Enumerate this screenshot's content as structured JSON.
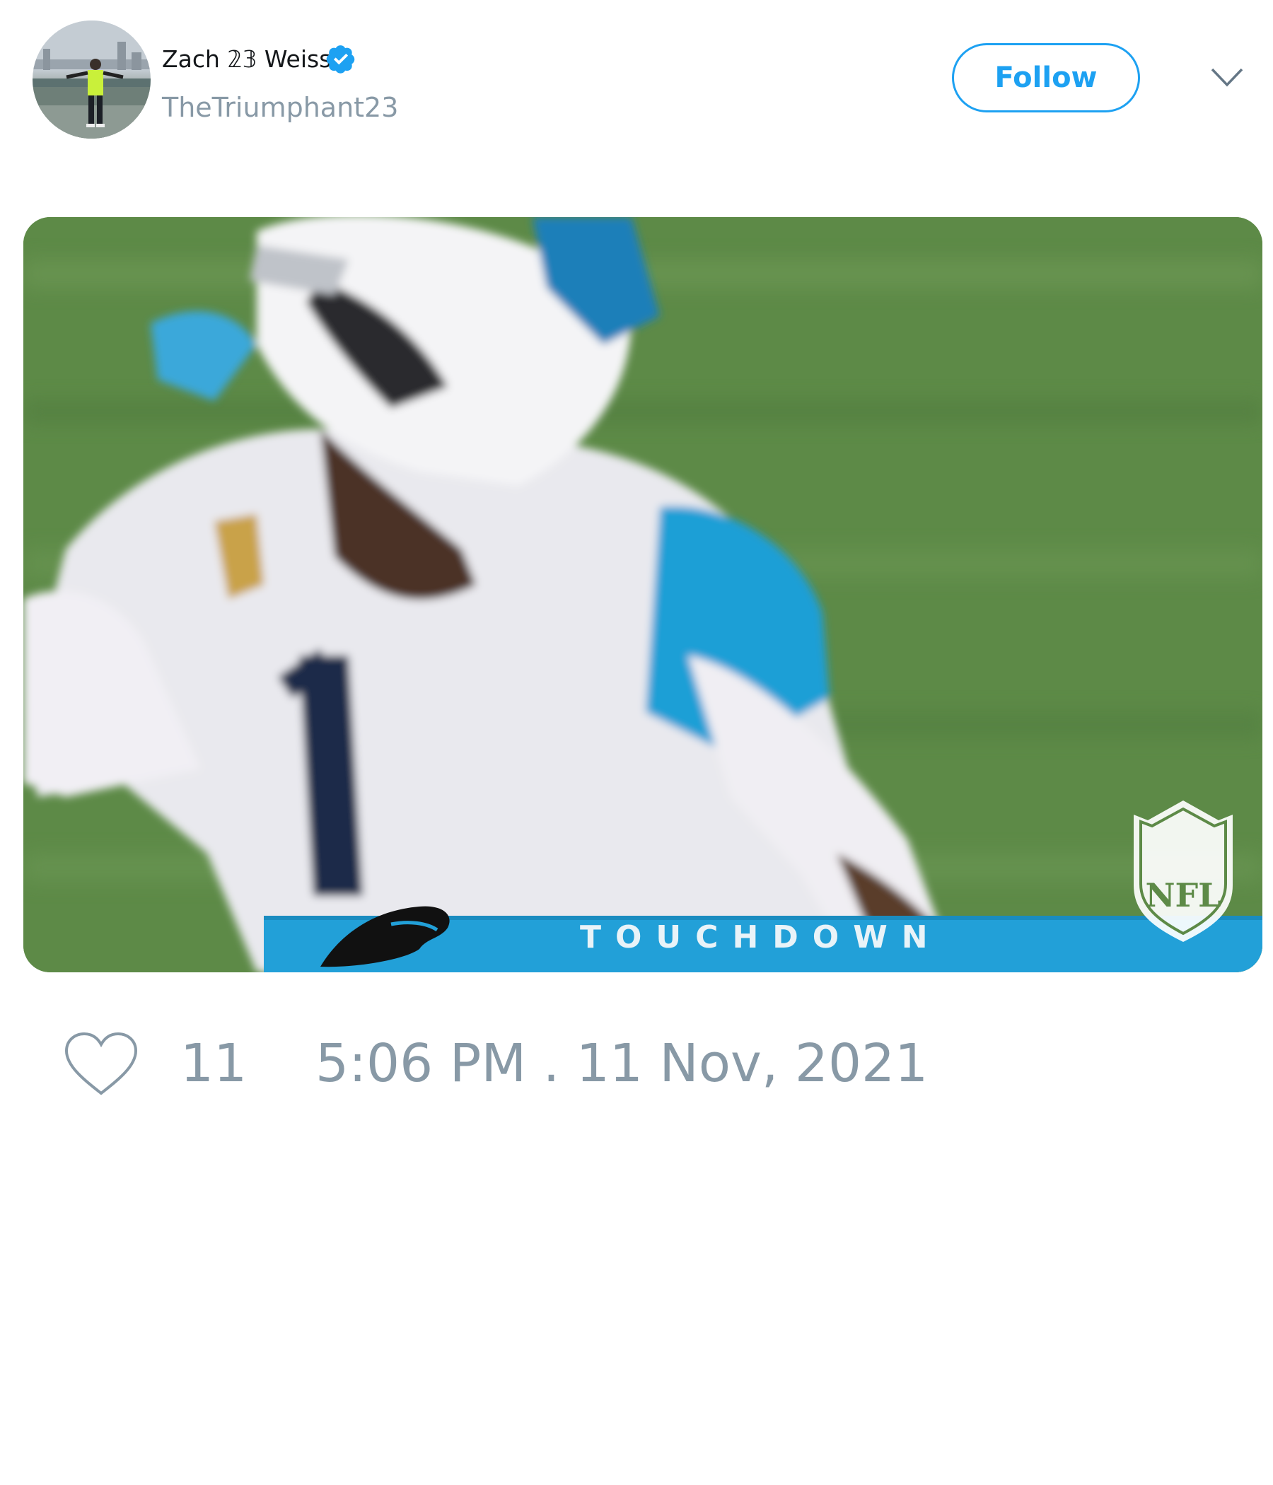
{
  "user": {
    "display_name": "Zach 𝟚𝟛 Weiss",
    "handle": "TheTriumphant23",
    "verified": true
  },
  "actions": {
    "follow_label": "Follow"
  },
  "media": {
    "banner_text": "TOUCHDOWN",
    "logo_text": "NFL"
  },
  "footer": {
    "like_count": "11",
    "timestamp": "5:06 PM . 11 Nov, 2021"
  },
  "colors": {
    "accent": "#1da1f2",
    "muted_text": "#8899a6",
    "name_text": "#14171a"
  },
  "icons": {
    "verified": "verified-badge-icon",
    "caret": "chevron-down-icon",
    "like": "heart-icon"
  }
}
